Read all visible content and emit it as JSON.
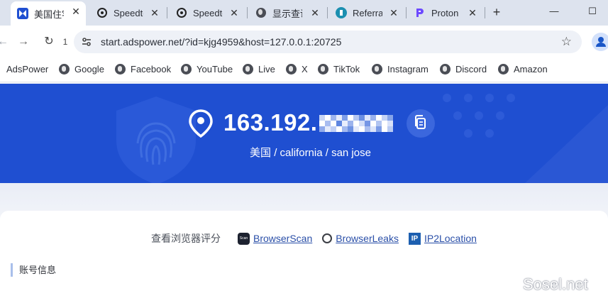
{
  "tabs": [
    {
      "title": "美国住宅",
      "icon": "adspower-icon",
      "active": true
    },
    {
      "title": "Speedtest",
      "icon": "speedtest-icon"
    },
    {
      "title": "Speedtest",
      "icon": "speedtest-icon"
    },
    {
      "title": "显示查询",
      "icon": "globe-icon"
    },
    {
      "title": "Referral",
      "icon": "referral-icon"
    },
    {
      "title": "Proton",
      "icon": "proton-icon"
    }
  ],
  "tab_close": "✕",
  "new_tab": "+",
  "window": {
    "minimize": "—",
    "maximize": "☐"
  },
  "nav": {
    "back": "←",
    "forward": "→",
    "reload": "↻",
    "badge": "1"
  },
  "url": "start.adspower.net/?id=kjg4959&host=127.0.0.1:20725",
  "star": "☆",
  "bookmarks": [
    "AdsPower",
    "Google",
    "Facebook",
    "YouTube",
    "Live",
    "X",
    "TikTok",
    "Instagram",
    "Discord",
    "Amazon"
  ],
  "hero": {
    "ip_visible": "163.192.",
    "location": "美国 / california / san jose"
  },
  "checks": {
    "label": "查看浏览器评分",
    "tools": [
      "BrowserScan",
      "BrowserLeaks",
      "IP2Location"
    ],
    "browserscan_icon_text": "Scan",
    "ip2location_icon_text": "IP"
  },
  "account_section": "账号信息",
  "watermark": "Sosel.net",
  "colors": {
    "hero_bg": "#1f4fd1",
    "link": "#2a4fa8",
    "accent_bar": "#a9bfeb"
  }
}
